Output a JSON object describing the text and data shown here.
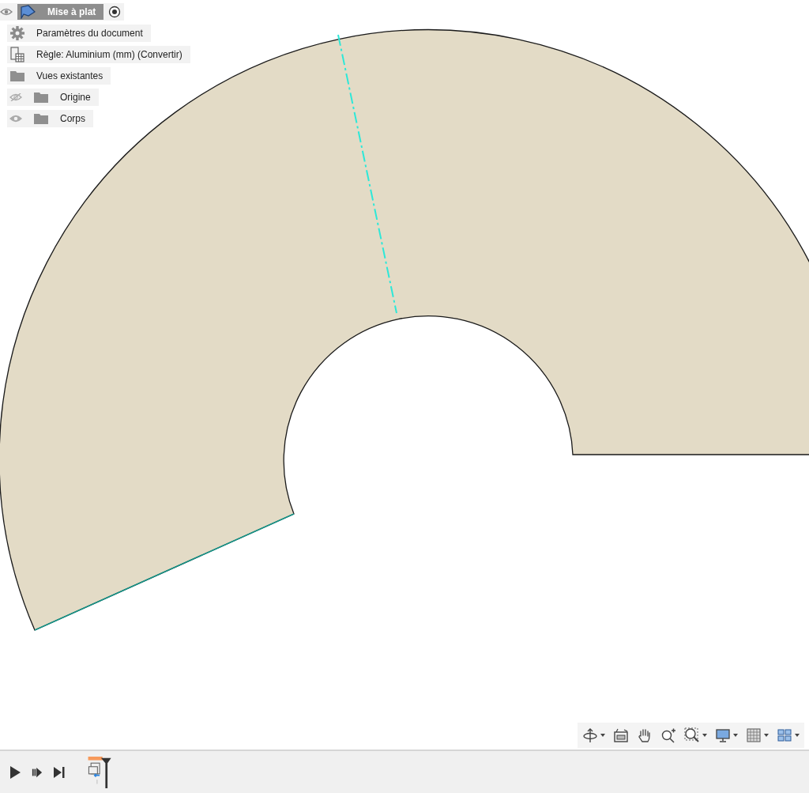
{
  "browser": {
    "root": {
      "label": "Mise à plat",
      "visible": true
    },
    "items": [
      {
        "label": "Paramètres du document",
        "kind": "settings"
      },
      {
        "label": "Règle: Aluminium (mm) (Convertir)",
        "kind": "rule"
      },
      {
        "label": "Vues existantes",
        "kind": "folder"
      },
      {
        "label": "Origine",
        "kind": "folder",
        "visible": false
      },
      {
        "label": "Corps",
        "kind": "folder",
        "visible": true
      }
    ]
  }
}
